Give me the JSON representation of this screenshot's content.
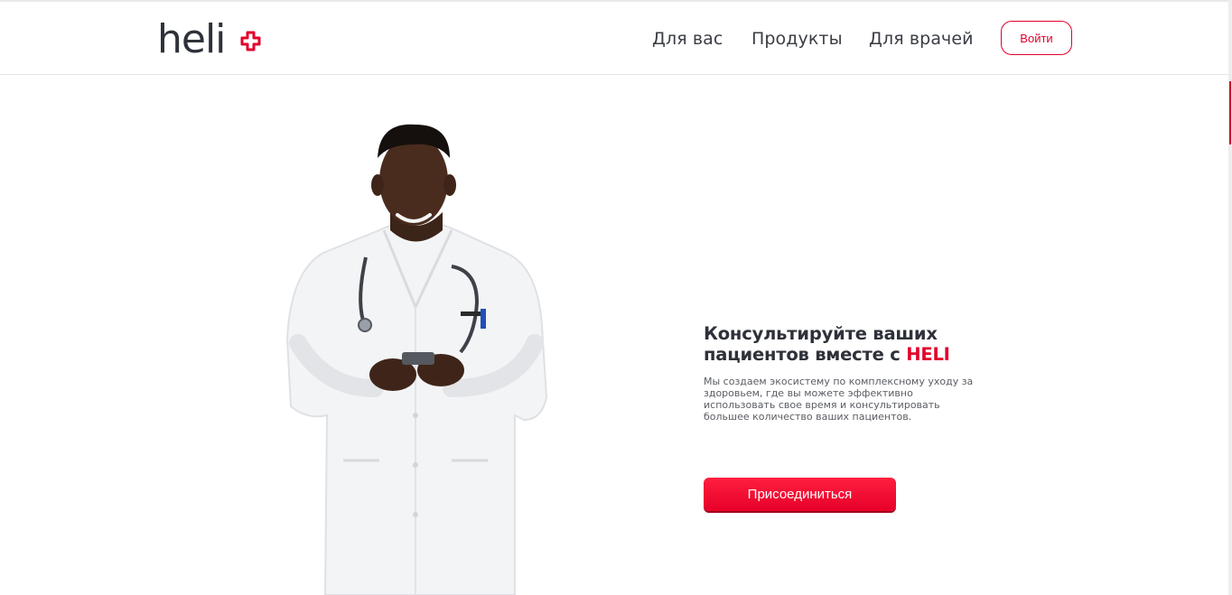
{
  "brand": {
    "logo_text": "heli",
    "accent_color": "#e3002b",
    "text_color": "#2e3139"
  },
  "nav": {
    "items": [
      "Для вас",
      "Продукты",
      "Для врачей"
    ],
    "login_label": "Войти"
  },
  "hero": {
    "headline_line1": "Консультируйте ваших",
    "headline_line2_prefix": "пациентов вместе с",
    "headline_brand": "HELI",
    "description": "Мы создаем экосистему по комплексному уходу за здоровьем, где вы можете эффективно использовать свое время и консультировать большее количество ваших пациентов.",
    "cta_label": "Присоединиться",
    "image_subject": "doctor-with-phone"
  }
}
